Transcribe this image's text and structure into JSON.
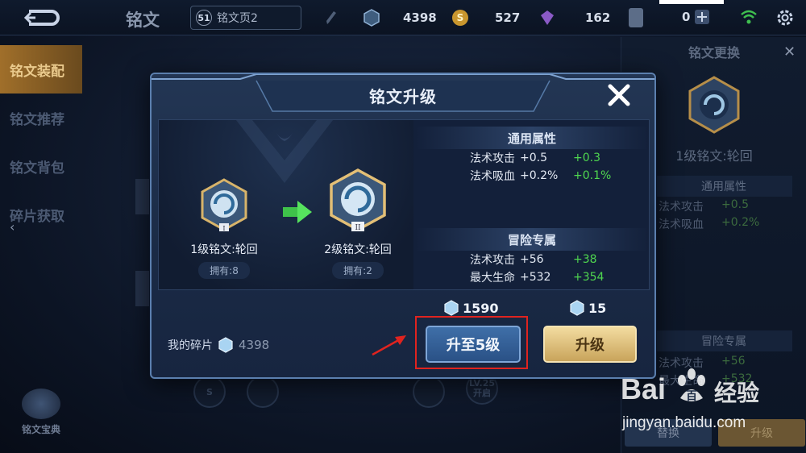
{
  "topbar": {
    "title": "铭文",
    "page_level": "51",
    "page_name": "铭文页2",
    "currencies": [
      {
        "icon": "crystal-icon",
        "value": "4398"
      },
      {
        "icon": "gold-coin-icon",
        "value": "527"
      },
      {
        "icon": "gem-icon",
        "value": "162"
      },
      {
        "icon": "card-icon",
        "value": "0"
      }
    ]
  },
  "sidebar": {
    "items": [
      {
        "label": "铭文装配",
        "active": true
      },
      {
        "label": "铭文推荐",
        "active": false
      },
      {
        "label": "铭文背包",
        "active": false
      },
      {
        "label": "碎片获取",
        "active": false
      }
    ],
    "codex_label": "铭文宝典"
  },
  "background": {
    "slot_level_label": "LV.25",
    "slot_level_sub": "开启"
  },
  "right_panel": {
    "title": "铭文更换",
    "rune_name": "1级铭文:轮回",
    "sections": [
      {
        "title": "通用属性",
        "stats": [
          {
            "name": "法术攻击",
            "value": "+0.5"
          },
          {
            "name": "法术吸血",
            "value": "+0.2%"
          }
        ]
      },
      {
        "title": "冒险专属",
        "stats": [
          {
            "name": "法术攻击",
            "value": "+56"
          },
          {
            "name": "最大生命",
            "value": "+532"
          }
        ]
      }
    ],
    "buttons": {
      "replace": "替换",
      "upgrade": "升级"
    }
  },
  "dialog": {
    "title": "铭文升级",
    "current": {
      "name": "1级铭文:轮回",
      "owned": "拥有:8",
      "tier": "I"
    },
    "next": {
      "name": "2级铭文:轮回",
      "owned": "拥有:2",
      "tier": "II"
    },
    "general": {
      "title": "通用属性",
      "rows": [
        {
          "name": "法术攻击",
          "value": "+0.5",
          "delta": "+0.3"
        },
        {
          "name": "法术吸血",
          "value": "+0.2%",
          "delta": "+0.1%"
        }
      ]
    },
    "adventure": {
      "title": "冒险专属",
      "rows": [
        {
          "name": "法术攻击",
          "value": "+56",
          "delta": "+38"
        },
        {
          "name": "最大生命",
          "value": "+532",
          "delta": "+354"
        }
      ]
    },
    "shards_label": "我的碎片",
    "shards_value": "4398",
    "cost_max": "1590",
    "cost_one": "15",
    "btn_max": "升至5级",
    "btn_upgrade": "升级"
  },
  "watermark": {
    "brand": "Bai",
    "brand2": "百",
    "brand_suffix": "经验",
    "url": "jingyan.baidu.com"
  },
  "colors": {
    "accent_green": "#4fd64f",
    "highlight": "#e0231f",
    "gold": "#c9a45b"
  }
}
